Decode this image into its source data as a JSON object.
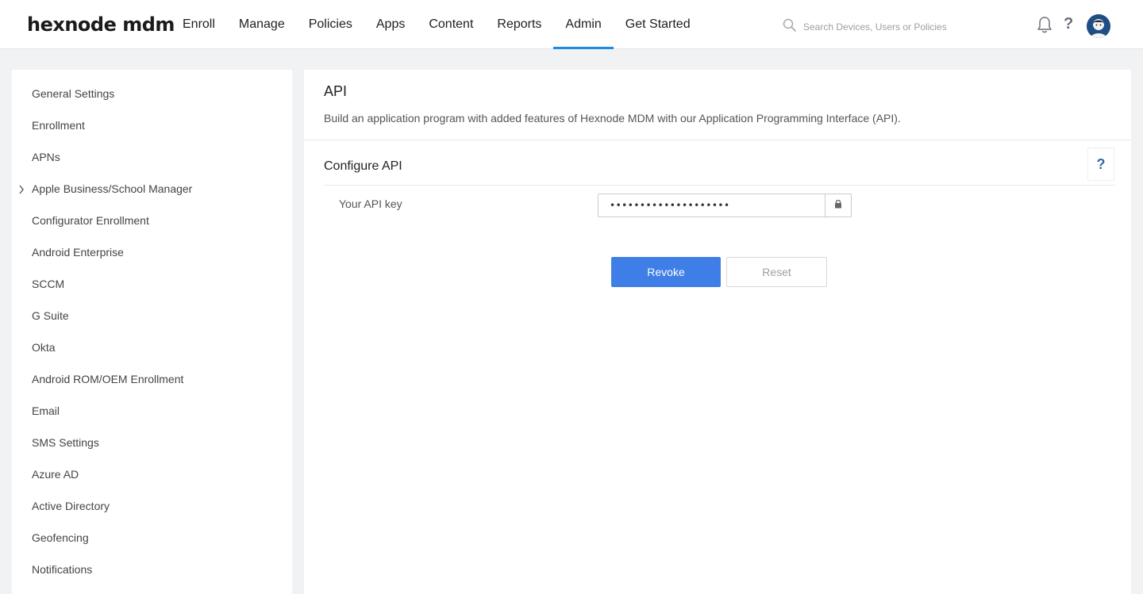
{
  "header": {
    "logo": "hexnode mdm",
    "nav": [
      {
        "label": "Enroll",
        "active": false
      },
      {
        "label": "Manage",
        "active": false
      },
      {
        "label": "Policies",
        "active": false
      },
      {
        "label": "Apps",
        "active": false
      },
      {
        "label": "Content",
        "active": false
      },
      {
        "label": "Reports",
        "active": false
      },
      {
        "label": "Admin",
        "active": true
      },
      {
        "label": "Get Started",
        "active": false
      }
    ],
    "search_placeholder": "Search Devices, Users or Policies",
    "icons": [
      "search-icon",
      "bell-icon",
      "help-icon",
      "avatar"
    ],
    "help_glyph": "?"
  },
  "sidebar": {
    "items": [
      {
        "label": "General Settings"
      },
      {
        "label": "Enrollment"
      },
      {
        "label": "APNs"
      },
      {
        "label": "Apple Business/School Manager",
        "expandable": true
      },
      {
        "label": "Configurator Enrollment"
      },
      {
        "label": "Android Enterprise"
      },
      {
        "label": "SCCM"
      },
      {
        "label": "G Suite"
      },
      {
        "label": "Okta"
      },
      {
        "label": "Android ROM/OEM Enrollment"
      },
      {
        "label": "Email"
      },
      {
        "label": "SMS Settings"
      },
      {
        "label": "Azure AD"
      },
      {
        "label": "Active Directory"
      },
      {
        "label": "Geofencing"
      },
      {
        "label": "Notifications"
      }
    ]
  },
  "main": {
    "title": "API",
    "description": "Build an application program with added features of Hexnode MDM with our Application Programming Interface (API).",
    "section_title": "Configure API",
    "help_glyph": "?",
    "api_key_label": "Your API key",
    "api_key_value": "••••••••••••••••••••",
    "revoke_label": "Revoke",
    "reset_label": "Reset"
  },
  "colors": {
    "accent": "#1e88e5",
    "primary_button": "#3f7ee6",
    "help_icon": "#3a67a8",
    "background": "#f1f2f4"
  }
}
